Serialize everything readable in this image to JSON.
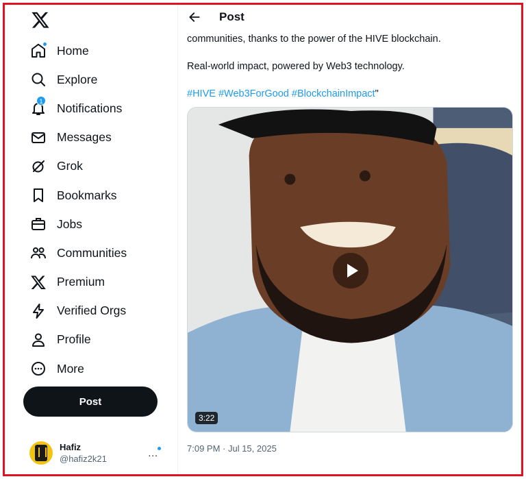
{
  "sidebar": {
    "logo": "x-logo-icon",
    "items": [
      {
        "label": "Home",
        "icon": "home-icon"
      },
      {
        "label": "Explore",
        "icon": "search-icon"
      },
      {
        "label": "Notifications",
        "icon": "bell-icon",
        "badge": "1"
      },
      {
        "label": "Messages",
        "icon": "envelope-icon"
      },
      {
        "label": "Grok",
        "icon": "grok-icon"
      },
      {
        "label": "Bookmarks",
        "icon": "bookmark-icon"
      },
      {
        "label": "Jobs",
        "icon": "briefcase-icon"
      },
      {
        "label": "Communities",
        "icon": "people-icon"
      },
      {
        "label": "Premium",
        "icon": "x-logo-icon"
      },
      {
        "label": "Verified Orgs",
        "icon": "lightning-icon"
      },
      {
        "label": "Profile",
        "icon": "person-icon"
      },
      {
        "label": "More",
        "icon": "more-circle-icon"
      }
    ],
    "post_button_label": "Post",
    "account": {
      "name": "Hafiz",
      "handle": "@hafiz2k21",
      "more": "..."
    }
  },
  "header": {
    "title": "Post"
  },
  "post": {
    "line1": "communities, thanks to the power of the HIVE blockchain.",
    "line2": "Real-world impact, powered by Web3 technology.",
    "hashtags": [
      "#HIVE",
      "#Web3ForGood",
      "#BlockchainImpact"
    ],
    "hashtag_suffix": "\"",
    "video": {
      "duration": "3:22"
    },
    "timestamp": "7:09 PM · Jul 15, 2025"
  },
  "colors": {
    "accent": "#1d9bf0",
    "frame": "#e0141e",
    "text": "#0f1419",
    "muted": "#536471"
  }
}
